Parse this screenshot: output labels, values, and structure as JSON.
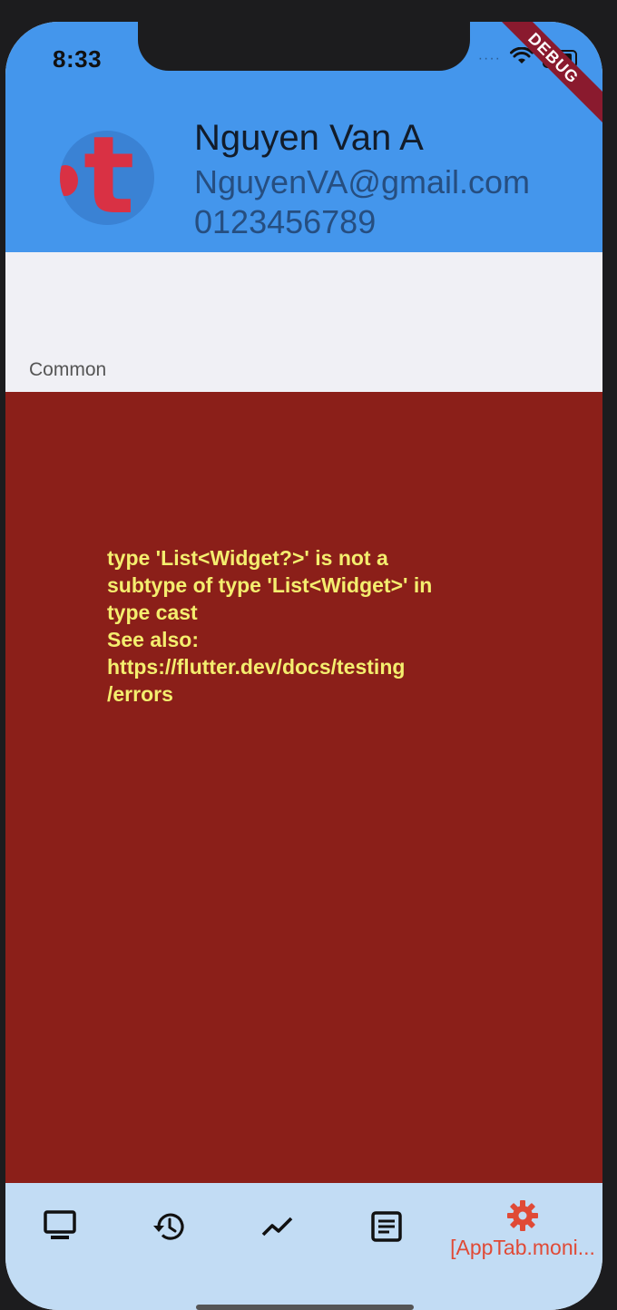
{
  "status_bar": {
    "time": "8:33",
    "signal": "····"
  },
  "debug_banner": "DEBUG",
  "profile": {
    "name": "Nguyen Van A",
    "email": "NguyenVA@gmail.com",
    "phone": "0123456789",
    "avatar_letter": "t"
  },
  "section": {
    "label": "Common"
  },
  "error": {
    "message": "type 'List<Widget?>' is not a\nsubtype of type 'List<Widget>' in\ntype cast\nSee also:\nhttps://flutter.dev/docs/testing\n/errors"
  },
  "tabbar": {
    "active_label": "[AppTab.moni...",
    "tabs": [
      {
        "icon": "monitor-icon"
      },
      {
        "icon": "history-icon"
      },
      {
        "icon": "trending-up-icon"
      },
      {
        "icon": "article-icon"
      },
      {
        "icon": "gear-icon"
      }
    ]
  },
  "colors": {
    "header": "#4496ec",
    "error_bg": "#8b1f19",
    "error_text": "#f4ee6e",
    "tabbar_bg": "#c2dcf4",
    "active_tab": "#e04a36"
  }
}
